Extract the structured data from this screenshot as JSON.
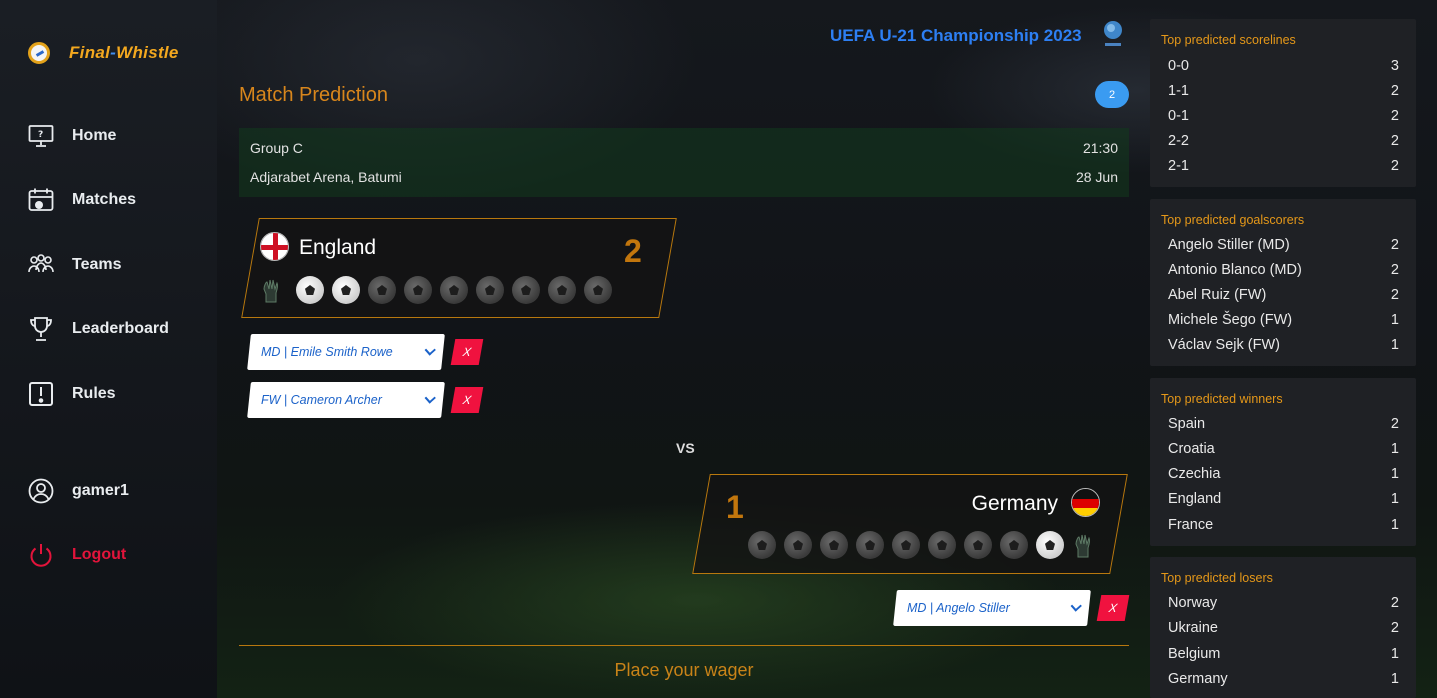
{
  "app": {
    "logo_part1": "Final",
    "logo_dash": "-",
    "logo_part2": "Whistle"
  },
  "nav": {
    "home": "Home",
    "matches": "Matches",
    "teams": "Teams",
    "leaderboard": "Leaderboard",
    "rules": "Rules",
    "user": "gamer1",
    "logout": "Logout"
  },
  "header": {
    "championship": "UEFA U-21 Championship 2023"
  },
  "prediction": {
    "title": "Match Prediction",
    "badge": "2",
    "group": "Group C",
    "time": "21:30",
    "venue": "Adjarabet Arena, Batumi",
    "date": "28 Jun",
    "vs": "VS",
    "wager": "Place your wager"
  },
  "home_team": {
    "name": "England",
    "score": "2",
    "scorers": [
      {
        "label": "MD | Emile Smith Rowe",
        "remove": "X"
      },
      {
        "label": "FW | Cameron Archer",
        "remove": "X"
      }
    ]
  },
  "away_team": {
    "name": "Germany",
    "score": "1",
    "scorers": [
      {
        "label": "MD | Angelo Stiller",
        "remove": "X"
      }
    ]
  },
  "stats": {
    "scorelines": {
      "title": "Top predicted scorelines",
      "rows": [
        {
          "label": "0-0",
          "count": "3"
        },
        {
          "label": "1-1",
          "count": "2"
        },
        {
          "label": "0-1",
          "count": "2"
        },
        {
          "label": "2-2",
          "count": "2"
        },
        {
          "label": "2-1",
          "count": "2"
        }
      ]
    },
    "goalscorers": {
      "title": "Top predicted goalscorers",
      "rows": [
        {
          "label": "Angelo Stiller (MD)",
          "count": "2"
        },
        {
          "label": "Antonio Blanco (MD)",
          "count": "2"
        },
        {
          "label": "Abel Ruiz (FW)",
          "count": "2"
        },
        {
          "label": "Michele Šego (FW)",
          "count": "1"
        },
        {
          "label": "Václav Sejk (FW)",
          "count": "1"
        }
      ]
    },
    "winners": {
      "title": "Top predicted winners",
      "rows": [
        {
          "label": "Spain",
          "count": "2"
        },
        {
          "label": "Croatia",
          "count": "1"
        },
        {
          "label": "Czechia",
          "count": "1"
        },
        {
          "label": "England",
          "count": "1"
        },
        {
          "label": "France",
          "count": "1"
        }
      ]
    },
    "losers": {
      "title": "Top predicted losers",
      "rows": [
        {
          "label": "Norway",
          "count": "2"
        },
        {
          "label": "Ukraine",
          "count": "2"
        },
        {
          "label": "Belgium",
          "count": "1"
        },
        {
          "label": "Germany",
          "count": "1"
        }
      ]
    }
  },
  "colors": {
    "accent_orange": "#d8861c",
    "link_blue": "#2d7ff3",
    "danger_red": "#f0123f"
  }
}
